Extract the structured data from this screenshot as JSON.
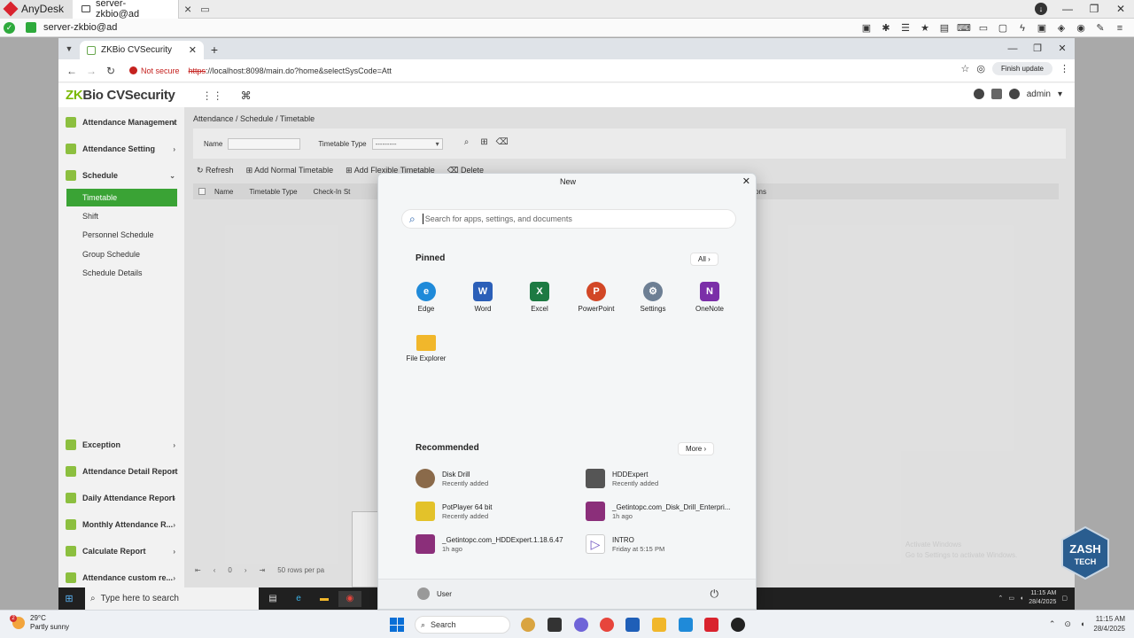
{
  "anydesk": {
    "app_name": "AnyDesk",
    "tab_label": "server-zkbio@ad",
    "address_label": "server-zkbio@ad"
  },
  "browser": {
    "tab_title": "ZKBio CVSecurity",
    "not_secure": "Not secure",
    "url_scheme": "https",
    "url_rest": "://localhost:8098/main.do?home&selectSysCode=Att",
    "finish_update": "Finish update"
  },
  "zkbio": {
    "logo_prefix": "ZK",
    "logo_rest": "Bio CVSecurity",
    "user": "admin",
    "breadcrumb": "Attendance / Schedule / Timetable",
    "sidebar_top": [
      {
        "label": "Attendance Management"
      },
      {
        "label": "Attendance Setting"
      },
      {
        "label": "Schedule"
      }
    ],
    "sidebar_sub": [
      {
        "label": "Timetable"
      },
      {
        "label": "Shift"
      },
      {
        "label": "Personnel Schedule"
      },
      {
        "label": "Group Schedule"
      },
      {
        "label": "Schedule Details"
      }
    ],
    "sidebar_bottom": [
      {
        "label": "Exception"
      },
      {
        "label": "Attendance Detail Report"
      },
      {
        "label": "Daily Attendance Report"
      },
      {
        "label": "Monthly Attendance R..."
      },
      {
        "label": "Calculate Report"
      },
      {
        "label": "Attendance custom re..."
      }
    ],
    "filter": {
      "name_label": "Name",
      "type_label": "Timetable Type",
      "type_value": "---------"
    },
    "toolbar": {
      "refresh": "Refresh",
      "add_normal": "Add Normal Timetable",
      "add_flexible": "Add Flexible Timetable",
      "delete": "Delete"
    },
    "columns": [
      "Name",
      "Timetable Type",
      "Check-In St",
      "ions"
    ],
    "pager": {
      "page": "0",
      "rows": "50 rows per pa"
    }
  },
  "start_menu": {
    "title": "New",
    "search_placeholder": "Search for apps, settings, and documents",
    "pinned_label": "Pinned",
    "all_label": "All",
    "pinned": [
      {
        "name": "Edge",
        "color": "#1f8ad9",
        "glyph": "e"
      },
      {
        "name": "Word",
        "color": "#2b5fb8",
        "glyph": "W"
      },
      {
        "name": "Excel",
        "color": "#1d7a43",
        "glyph": "X"
      },
      {
        "name": "PowerPoint",
        "color": "#d24726",
        "glyph": "P"
      },
      {
        "name": "Settings",
        "color": "#6d7f94",
        "glyph": "⚙"
      },
      {
        "name": "OneNote",
        "color": "#7b2fa8",
        "glyph": "N"
      },
      {
        "name": "File Explorer",
        "color": "#f1b72b",
        "glyph": ""
      }
    ],
    "recommended_label": "Recommended",
    "more_label": "More",
    "recommended": [
      {
        "name": "Disk Drill",
        "sub": "Recently added",
        "color": "#8a6a4a"
      },
      {
        "name": "HDDExpert",
        "sub": "Recently added",
        "color": "#555555"
      },
      {
        "name": "PotPlayer 64 bit",
        "sub": "Recently added",
        "color": "#e3c22a"
      },
      {
        "name": "_Getintopc.com_Disk_Drill_Enterpri...",
        "sub": "1h ago",
        "color": "#8b2f7a"
      },
      {
        "name": "_Getintopc.com_HDDExpert.1.18.6.47",
        "sub": "1h ago",
        "color": "#8b2f7a"
      },
      {
        "name": "INTRO",
        "sub": "Friday at 5:15 PM",
        "color": "#6b4fbf"
      }
    ],
    "user": "User"
  },
  "inner_taskbar": {
    "search_placeholder": "Type here to search",
    "time": "11:15 AM",
    "date": "28/4/2025"
  },
  "taskbar": {
    "weather_temp": "29°C",
    "weather_desc": "Partly sunny",
    "weather_badge": "2",
    "search": "Search",
    "time": "11:15 AM",
    "date": "28/4/2025"
  },
  "overlay": {
    "watermark_line1": "Activate Windows",
    "watermark_line2": "Go to Settings to activate Windows.",
    "brand_top": "ZASH",
    "brand_bottom": "TECH"
  }
}
